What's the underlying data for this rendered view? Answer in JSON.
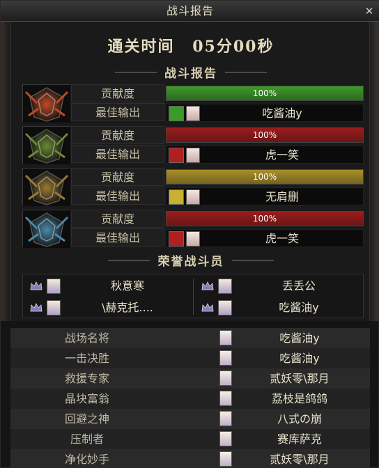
{
  "window": {
    "title": "战斗报告",
    "close_icon": "close-icon"
  },
  "clear_time": {
    "label": "通关时间",
    "value": "05分00秒"
  },
  "report": {
    "heading": "战斗报告",
    "rows": [
      {
        "emblem": "fire-emblem-icon",
        "emblem_color": "#c04a24",
        "contribution_label": "贡献度",
        "contribution": "100%",
        "fill_fraction": 1.0,
        "bar_color": "#3f9a2a",
        "best_label": "最佳输出",
        "class_icon": "green-blade-icon",
        "class_color": "#3a9a2a",
        "player": "吃酱油y"
      },
      {
        "emblem": "vine-emblem-icon",
        "emblem_color": "#6a8a30",
        "contribution_label": "贡献度",
        "contribution": "100%",
        "fill_fraction": 1.0,
        "bar_color": "#9a1c1c",
        "best_label": "最佳输出",
        "class_icon": "red-claw-icon",
        "class_color": "#b02020",
        "player": "虎一笑"
      },
      {
        "emblem": "gold-emblem-icon",
        "emblem_color": "#9a7a30",
        "contribution_label": "贡献度",
        "contribution": "100%",
        "fill_fraction": 1.0,
        "bar_color": "#a8902a",
        "best_label": "最佳输出",
        "class_icon": "gold-blade-icon",
        "class_color": "#c8b030",
        "player": "无肩删"
      },
      {
        "emblem": "ice-emblem-icon",
        "emblem_color": "#4a8aa8",
        "contribution_label": "贡献度",
        "contribution": "100%",
        "fill_fraction": 1.0,
        "bar_color": "#9a1c1c",
        "best_label": "最佳输出",
        "class_icon": "red-claw-icon",
        "class_color": "#b02020",
        "player": "虎一笑"
      }
    ]
  },
  "honor": {
    "heading": "荣誉战斗员",
    "members": [
      {
        "name": "秋意寒",
        "crown_icon": "crown-icon"
      },
      {
        "name": "丢丢公",
        "crown_icon": "crown-icon"
      },
      {
        "name": "\\赫克托....",
        "crown_icon": "crown-icon"
      },
      {
        "name": "吃酱油y",
        "crown_icon": "crown-icon"
      }
    ]
  },
  "awards": [
    {
      "title": "战场名将",
      "player": "吃酱油y"
    },
    {
      "title": "一击决胜",
      "player": "吃酱油y"
    },
    {
      "title": "救援专家",
      "player": "贰妖零\\那月"
    },
    {
      "title": "晶块富翁",
      "player": "荔枝是鸽鸽"
    },
    {
      "title": "回避之神",
      "player": "八式の崩"
    },
    {
      "title": "压制者",
      "player": "赛库萨克"
    },
    {
      "title": "净化妙手",
      "player": "贰妖零\\那月"
    }
  ]
}
